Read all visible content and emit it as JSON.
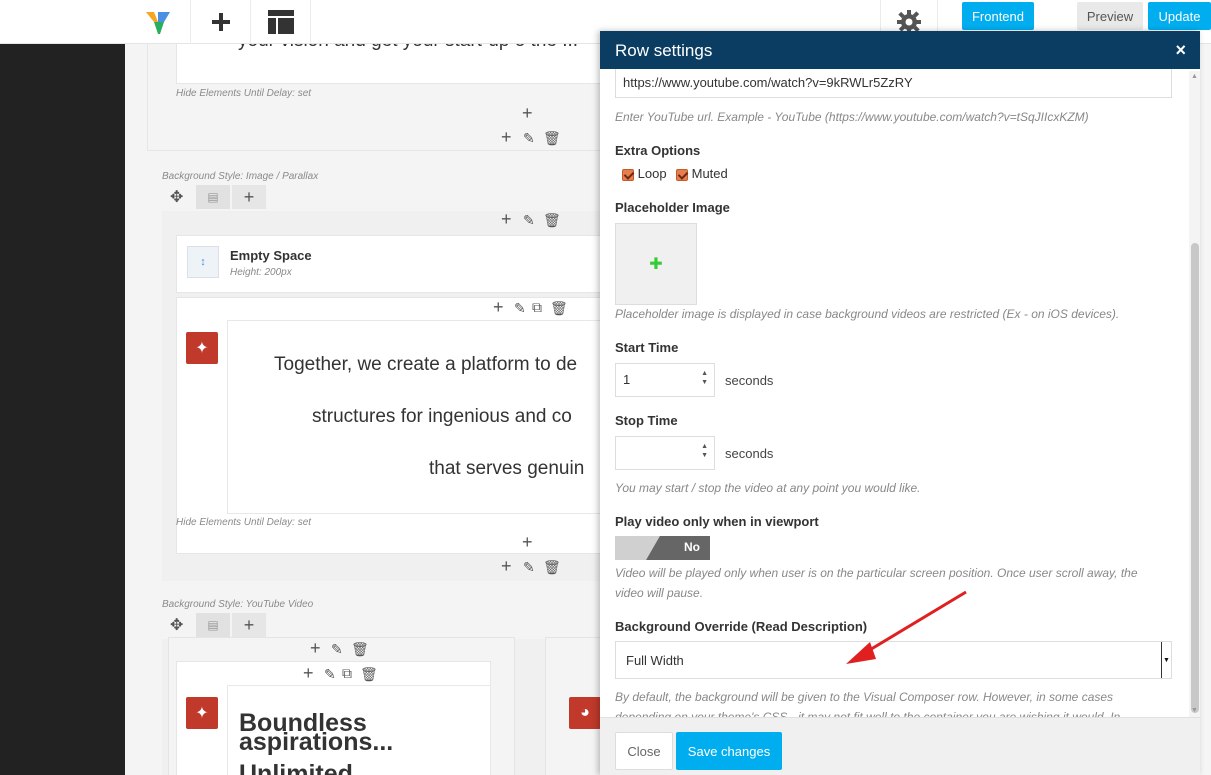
{
  "toolbar": {
    "frontend_label": "Frontend",
    "preview_label": "Preview",
    "update_label": "Update"
  },
  "canvas": {
    "partial_heading": "your vision and get your start-up o the ...",
    "hide_delay_1": "Hide Elements Until Delay: set",
    "bg_style_1": "Background Style: Image / Parallax",
    "empty_space_title": "Empty Space",
    "empty_space_meta": "Height: 200px",
    "text_line_1": "Together, we create a platform to de",
    "text_line_2": "structures for ingenious and co",
    "text_line_3": "that serves genuin",
    "hide_delay_2": "Hide Elements Until Delay: set",
    "bg_style_2": "Background Style: YouTube Video",
    "heading_line_1": "Boundless",
    "heading_line_2": "aspirations...",
    "heading_line_3": "Unlimited"
  },
  "modal": {
    "title": "Row settings",
    "close_label": "×",
    "youtube_url": "https://www.youtube.com/watch?v=9kRWLr5ZzRY",
    "youtube_desc": "Enter YouTube url. Example - YouTube (https://www.youtube.com/watch?v=tSqJIIcxKZM)",
    "extra_options_label": "Extra Options",
    "loop_label": "Loop",
    "muted_label": "Muted",
    "placeholder_label": "Placeholder Image",
    "placeholder_desc": "Placeholder image is displayed in case background videos are restricted (Ex - on iOS devices).",
    "start_time_label": "Start Time",
    "start_time_value": "1",
    "seconds_1": "seconds",
    "stop_time_label": "Stop Time",
    "stop_time_value": "",
    "seconds_2": "seconds",
    "time_desc": "You may start / stop the video at any point you would like.",
    "viewport_label": "Play video only when in viewport",
    "toggle_state": "No",
    "viewport_desc_1": "Video will be played only when user is on the particular screen position. Once user scroll away, the",
    "viewport_desc_2": "video will pause.",
    "override_label": "Background Override (Read Description)",
    "override_value": "Full Width",
    "override_desc_1": "By default, the background will be given to the Visual Composer row. However, in some cases",
    "override_desc_2": "depending on your theme's CSS - it may not fit well to the container you are wishing it would. In",
    "close_button": "Close",
    "save_button": "Save changes"
  },
  "colors": {
    "modal_header": "#0b3c62",
    "accent_blue": "#00aef0",
    "element_red": "#c0392b",
    "arrow_red": "#e02020"
  },
  "icons": [
    "vc-logo-icon",
    "add-element-icon",
    "templates-icon",
    "settings-gear-icon",
    "move-icon",
    "column-layout-icon",
    "add-icon",
    "edit-pencil-icon",
    "clone-icon",
    "delete-trash-icon",
    "empty-space-icon",
    "text-block-icon"
  ]
}
